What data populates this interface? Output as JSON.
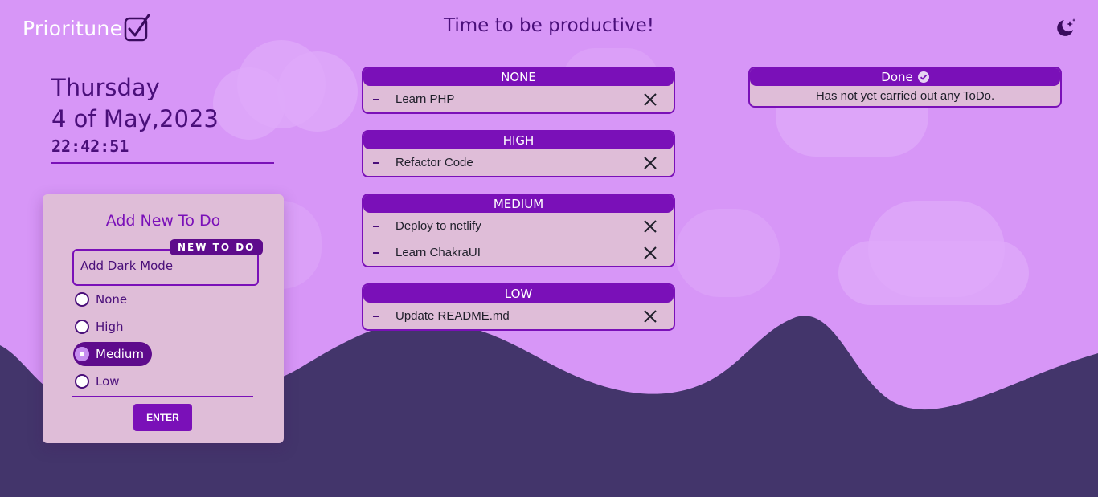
{
  "brand": {
    "logo_text": "Prioritune"
  },
  "header": {
    "title": "Time to be productive!"
  },
  "theme_toggle": {
    "icon": "moon-stars-icon"
  },
  "date_panel": {
    "weekday": "Thursday",
    "date": "4 of May,2023",
    "time": "22:42:51"
  },
  "add_form": {
    "title": "Add New To Do",
    "input_tag": "NEW TO DO",
    "input_value": "Add Dark Mode",
    "priorities": [
      {
        "label": "None",
        "selected": false
      },
      {
        "label": "High",
        "selected": false
      },
      {
        "label": "Medium",
        "selected": true
      },
      {
        "label": "Low",
        "selected": false
      }
    ],
    "submit_label": "ENTER"
  },
  "groups": [
    {
      "title": "NONE",
      "tasks": [
        "Learn PHP"
      ]
    },
    {
      "title": "HIGH",
      "tasks": [
        "Refactor Code"
      ]
    },
    {
      "title": "MEDIUM",
      "tasks": [
        "Deploy to netlify",
        "Learn ChakraUI"
      ]
    },
    {
      "title": "LOW",
      "tasks": [
        "Update README.md"
      ]
    }
  ],
  "done": {
    "title": "Done",
    "empty_message": "Has not yet carried out any ToDo."
  },
  "colors": {
    "background": "#d796f7",
    "accent": "#7a10b8",
    "mountain": "#43356b",
    "card": "#dfbdd8"
  }
}
